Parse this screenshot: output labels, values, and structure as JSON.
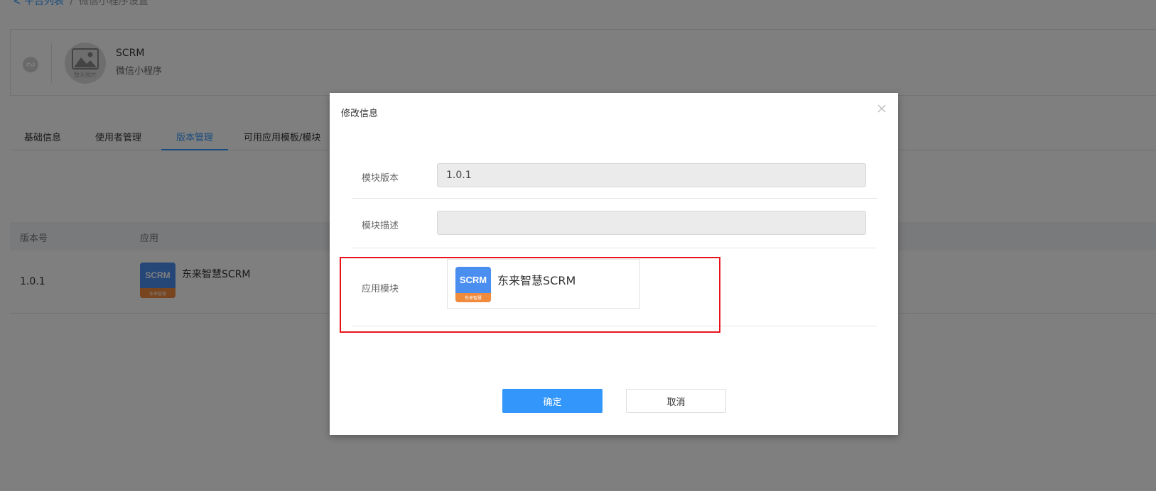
{
  "breadcrumb": {
    "back_label": "< 平台列表",
    "separator": "/",
    "current": "微信小程序设置"
  },
  "app_card": {
    "platform_icon": "wechat-miniprogram-icon",
    "avatar_caption": "暂无图片",
    "name": "SCRM",
    "type": "微信小程序"
  },
  "tabs": [
    {
      "label": "基础信息",
      "active": false
    },
    {
      "label": "使用者管理",
      "active": false
    },
    {
      "label": "版本管理",
      "active": true
    },
    {
      "label": "可用应用模板/模块",
      "active": false
    }
  ],
  "table": {
    "headers": [
      "版本号",
      "应用"
    ],
    "rows": [
      {
        "version": "1.0.1",
        "app_name": "东来智慧SCRM"
      }
    ]
  },
  "logo": {
    "top_text": "SCRM",
    "bottom_text": "东来智慧"
  },
  "modal": {
    "title": "修改信息",
    "close_icon": "close-icon",
    "fields": {
      "version": {
        "label": "模块版本",
        "value": "1.0.1"
      },
      "description": {
        "label": "模块描述",
        "value": ""
      },
      "module": {
        "label": "应用模块",
        "app_name": "东来智慧SCRM"
      }
    },
    "ok_label": "确定",
    "cancel_label": "取消"
  },
  "colors": {
    "accent": "#3296fa",
    "highlight": "#e8131a",
    "logo_blue": "#4a8ff0",
    "logo_orange": "#f08b3e"
  }
}
